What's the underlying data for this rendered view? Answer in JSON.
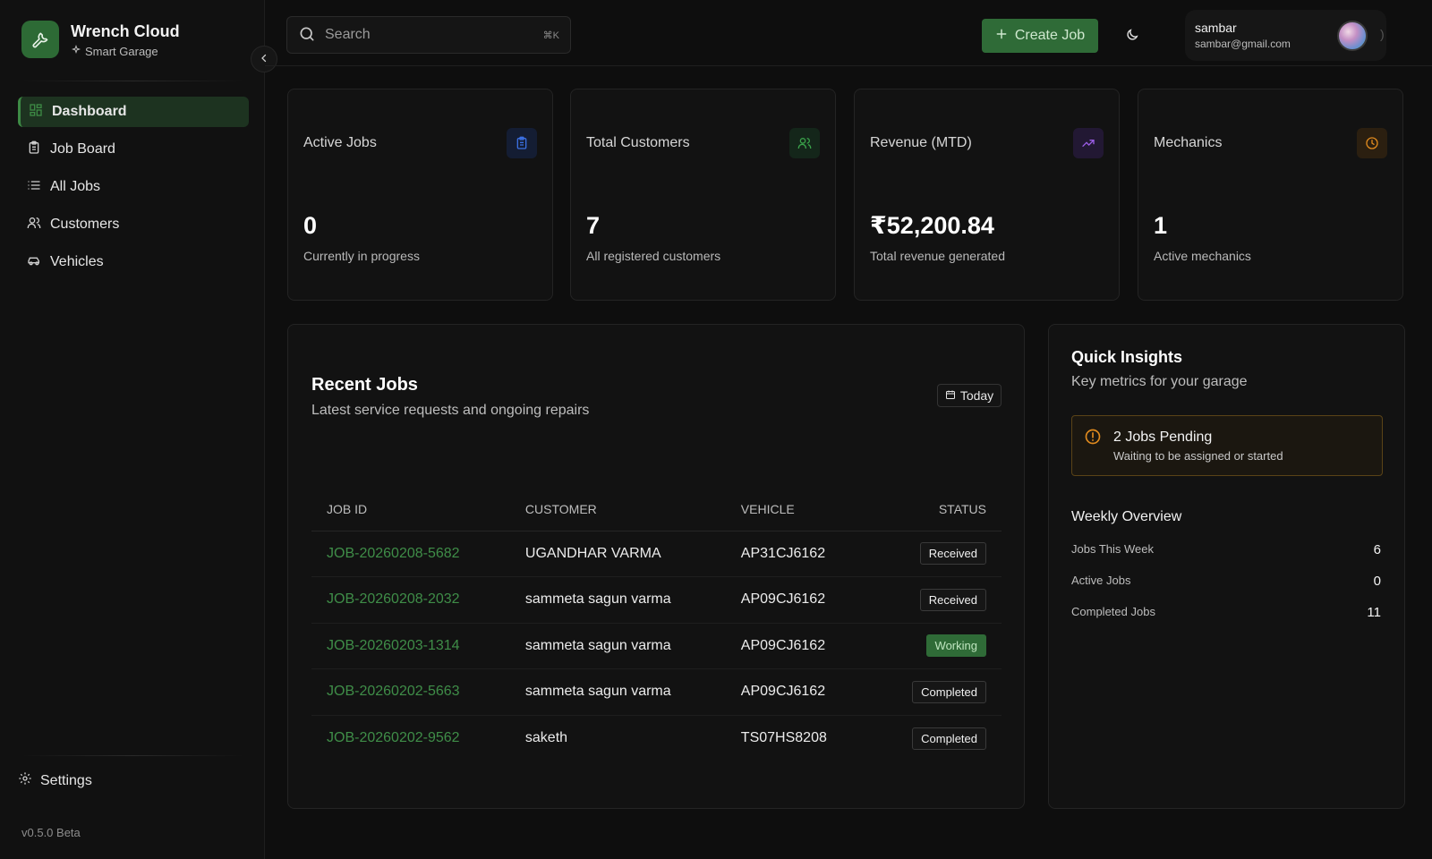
{
  "brand": {
    "title": "Wrench Cloud",
    "subtitle": "Smart Garage",
    "accent": "#2d6a35"
  },
  "sidebar": {
    "items": [
      {
        "label": "Dashboard",
        "icon": "dashboard-grid-icon",
        "active": true
      },
      {
        "label": "Job Board",
        "icon": "clipboard-icon",
        "active": false
      },
      {
        "label": "All Jobs",
        "icon": "list-icon",
        "active": false
      },
      {
        "label": "Customers",
        "icon": "users-icon",
        "active": false
      },
      {
        "label": "Vehicles",
        "icon": "car-icon",
        "active": false
      }
    ],
    "settings_label": "Settings",
    "version": "v0.5.0 Beta"
  },
  "header": {
    "search_placeholder": "Search",
    "search_shortcut": "⌘K",
    "create_label": "Create Job",
    "user": {
      "name": "sambar",
      "email": "sambar@gmail.com"
    }
  },
  "stats": [
    {
      "title": "Active Jobs",
      "value": "0",
      "subtitle": "Currently in progress",
      "icon": "clipboard-list-icon",
      "color": "#3b6fe0"
    },
    {
      "title": "Total Customers",
      "value": "7",
      "subtitle": "All registered customers",
      "icon": "users-icon",
      "color": "#3aa14a"
    },
    {
      "title": "Revenue (MTD)",
      "value": "₹52,200.84",
      "subtitle": "Total revenue generated",
      "icon": "trending-up-icon",
      "color": "#9b5de5"
    },
    {
      "title": "Mechanics",
      "value": "1",
      "subtitle": "Active mechanics",
      "icon": "clock-icon",
      "color": "#e08a1e"
    }
  ],
  "recent_jobs": {
    "title": "Recent Jobs",
    "subtitle": "Latest service requests and ongoing repairs",
    "filter_label": "Today",
    "columns": [
      "JOB ID",
      "CUSTOMER",
      "VEHICLE",
      "STATUS"
    ],
    "rows": [
      {
        "job_id": "JOB-20260208-5682",
        "customer": "UGANDHAR VARMA",
        "vehicle": "AP31CJ6162",
        "status": "Received"
      },
      {
        "job_id": "JOB-20260208-2032",
        "customer": "sammeta sagun varma",
        "vehicle": "AP09CJ6162",
        "status": "Received"
      },
      {
        "job_id": "JOB-20260203-1314",
        "customer": "sammeta sagun varma",
        "vehicle": "AP09CJ6162",
        "status": "Working"
      },
      {
        "job_id": "JOB-20260202-5663",
        "customer": "sammeta sagun varma",
        "vehicle": "AP09CJ6162",
        "status": "Completed"
      },
      {
        "job_id": "JOB-20260202-9562",
        "customer": "saketh",
        "vehicle": "TS07HS8208",
        "status": "Completed"
      }
    ]
  },
  "insights": {
    "title": "Quick Insights",
    "subtitle": "Key metrics for your garage",
    "alert": {
      "title": "2 Jobs Pending",
      "subtitle": "Waiting to be assigned or started",
      "color": "#e08a1e"
    },
    "weekly_title": "Weekly Overview",
    "weekly": [
      {
        "label": "Jobs This Week",
        "value": "6"
      },
      {
        "label": "Active Jobs",
        "value": "0"
      },
      {
        "label": "Completed Jobs",
        "value": "11"
      }
    ]
  }
}
